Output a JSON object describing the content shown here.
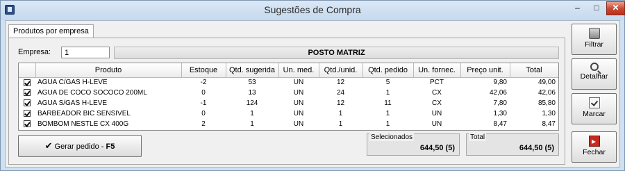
{
  "window": {
    "title": "Sugestões de Compra",
    "controls": {
      "minimize": "–",
      "maximize": "□",
      "close": "✕"
    }
  },
  "tab": {
    "label": "Produtos por empresa"
  },
  "empresa": {
    "label": "Empresa:",
    "value": "1",
    "name": "POSTO MATRIZ"
  },
  "grid": {
    "columns": [
      "",
      "Produto",
      "Estoque",
      "Qtd. sugerida",
      "Un. med.",
      "Qtd./unid.",
      "Qtd. pedido",
      "Un. fornec.",
      "Preço unit.",
      "Total"
    ],
    "rows": [
      {
        "checked": true,
        "produto": "AGUA C/GAS H-LEVE",
        "estoque": "-2",
        "sugerida": "53",
        "unmed": "UN",
        "qtdunid": "12",
        "pedido": "5",
        "unfornec": "PCT",
        "preco": "9,80",
        "total": "49,00"
      },
      {
        "checked": true,
        "produto": "AGUA DE COCO SOCOCO 200ML",
        "estoque": "0",
        "sugerida": "13",
        "unmed": "UN",
        "qtdunid": "24",
        "pedido": "1",
        "unfornec": "CX",
        "preco": "42,06",
        "total": "42,06"
      },
      {
        "checked": true,
        "produto": "AGUA S/GAS H-LEVE",
        "estoque": "-1",
        "sugerida": "124",
        "unmed": "UN",
        "qtdunid": "12",
        "pedido": "11",
        "unfornec": "CX",
        "preco": "7,80",
        "total": "85,80"
      },
      {
        "checked": true,
        "produto": "BARBEADOR BIC SENSIVEL",
        "estoque": "0",
        "sugerida": "1",
        "unmed": "UN",
        "qtdunid": "1",
        "pedido": "1",
        "unfornec": "UN",
        "preco": "1,30",
        "total": "1,30"
      },
      {
        "checked": true,
        "produto": "BOMBOM NESTLE CX 400G",
        "estoque": "2",
        "sugerida": "1",
        "unmed": "UN",
        "qtdunid": "1",
        "pedido": "1",
        "unfornec": "UN",
        "preco": "8,47",
        "total": "8,47"
      }
    ]
  },
  "actions": {
    "gerar_prefix": "Gerar pedido - ",
    "gerar_key": "F5",
    "gerar_icon": "checkmark-icon"
  },
  "summary": {
    "selecionados_label": "Selecionados",
    "selecionados_value": "644,50 (5)",
    "total_label": "Total",
    "total_value": "644,50 (5)"
  },
  "side_buttons": [
    {
      "label": "Filtrar",
      "icon": "filter-icon"
    },
    {
      "label": "Detalhar",
      "icon": "magnifier-icon"
    },
    {
      "label": "Marcar",
      "icon": "mark-icon"
    },
    {
      "label": "Fechar",
      "icon": "exit-icon"
    }
  ],
  "colors": {
    "close_button": "#c9452f",
    "window_frame": "#cfe0f1"
  }
}
